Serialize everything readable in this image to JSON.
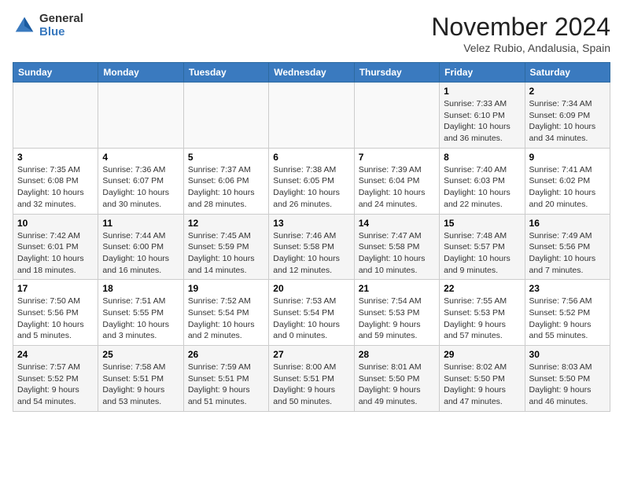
{
  "header": {
    "logo": {
      "general": "General",
      "blue": "Blue"
    },
    "title": "November 2024",
    "location": "Velez Rubio, Andalusia, Spain"
  },
  "weekdays": [
    "Sunday",
    "Monday",
    "Tuesday",
    "Wednesday",
    "Thursday",
    "Friday",
    "Saturday"
  ],
  "weeks": [
    [
      {
        "day": "",
        "info": ""
      },
      {
        "day": "",
        "info": ""
      },
      {
        "day": "",
        "info": ""
      },
      {
        "day": "",
        "info": ""
      },
      {
        "day": "",
        "info": ""
      },
      {
        "day": "1",
        "info": "Sunrise: 7:33 AM\nSunset: 6:10 PM\nDaylight: 10 hours\nand 36 minutes."
      },
      {
        "day": "2",
        "info": "Sunrise: 7:34 AM\nSunset: 6:09 PM\nDaylight: 10 hours\nand 34 minutes."
      }
    ],
    [
      {
        "day": "3",
        "info": "Sunrise: 7:35 AM\nSunset: 6:08 PM\nDaylight: 10 hours\nand 32 minutes."
      },
      {
        "day": "4",
        "info": "Sunrise: 7:36 AM\nSunset: 6:07 PM\nDaylight: 10 hours\nand 30 minutes."
      },
      {
        "day": "5",
        "info": "Sunrise: 7:37 AM\nSunset: 6:06 PM\nDaylight: 10 hours\nand 28 minutes."
      },
      {
        "day": "6",
        "info": "Sunrise: 7:38 AM\nSunset: 6:05 PM\nDaylight: 10 hours\nand 26 minutes."
      },
      {
        "day": "7",
        "info": "Sunrise: 7:39 AM\nSunset: 6:04 PM\nDaylight: 10 hours\nand 24 minutes."
      },
      {
        "day": "8",
        "info": "Sunrise: 7:40 AM\nSunset: 6:03 PM\nDaylight: 10 hours\nand 22 minutes."
      },
      {
        "day": "9",
        "info": "Sunrise: 7:41 AM\nSunset: 6:02 PM\nDaylight: 10 hours\nand 20 minutes."
      }
    ],
    [
      {
        "day": "10",
        "info": "Sunrise: 7:42 AM\nSunset: 6:01 PM\nDaylight: 10 hours\nand 18 minutes."
      },
      {
        "day": "11",
        "info": "Sunrise: 7:44 AM\nSunset: 6:00 PM\nDaylight: 10 hours\nand 16 minutes."
      },
      {
        "day": "12",
        "info": "Sunrise: 7:45 AM\nSunset: 5:59 PM\nDaylight: 10 hours\nand 14 minutes."
      },
      {
        "day": "13",
        "info": "Sunrise: 7:46 AM\nSunset: 5:58 PM\nDaylight: 10 hours\nand 12 minutes."
      },
      {
        "day": "14",
        "info": "Sunrise: 7:47 AM\nSunset: 5:58 PM\nDaylight: 10 hours\nand 10 minutes."
      },
      {
        "day": "15",
        "info": "Sunrise: 7:48 AM\nSunset: 5:57 PM\nDaylight: 10 hours\nand 9 minutes."
      },
      {
        "day": "16",
        "info": "Sunrise: 7:49 AM\nSunset: 5:56 PM\nDaylight: 10 hours\nand 7 minutes."
      }
    ],
    [
      {
        "day": "17",
        "info": "Sunrise: 7:50 AM\nSunset: 5:56 PM\nDaylight: 10 hours\nand 5 minutes."
      },
      {
        "day": "18",
        "info": "Sunrise: 7:51 AM\nSunset: 5:55 PM\nDaylight: 10 hours\nand 3 minutes."
      },
      {
        "day": "19",
        "info": "Sunrise: 7:52 AM\nSunset: 5:54 PM\nDaylight: 10 hours\nand 2 minutes."
      },
      {
        "day": "20",
        "info": "Sunrise: 7:53 AM\nSunset: 5:54 PM\nDaylight: 10 hours\nand 0 minutes."
      },
      {
        "day": "21",
        "info": "Sunrise: 7:54 AM\nSunset: 5:53 PM\nDaylight: 9 hours\nand 59 minutes."
      },
      {
        "day": "22",
        "info": "Sunrise: 7:55 AM\nSunset: 5:53 PM\nDaylight: 9 hours\nand 57 minutes."
      },
      {
        "day": "23",
        "info": "Sunrise: 7:56 AM\nSunset: 5:52 PM\nDaylight: 9 hours\nand 55 minutes."
      }
    ],
    [
      {
        "day": "24",
        "info": "Sunrise: 7:57 AM\nSunset: 5:52 PM\nDaylight: 9 hours\nand 54 minutes."
      },
      {
        "day": "25",
        "info": "Sunrise: 7:58 AM\nSunset: 5:51 PM\nDaylight: 9 hours\nand 53 minutes."
      },
      {
        "day": "26",
        "info": "Sunrise: 7:59 AM\nSunset: 5:51 PM\nDaylight: 9 hours\nand 51 minutes."
      },
      {
        "day": "27",
        "info": "Sunrise: 8:00 AM\nSunset: 5:51 PM\nDaylight: 9 hours\nand 50 minutes."
      },
      {
        "day": "28",
        "info": "Sunrise: 8:01 AM\nSunset: 5:50 PM\nDaylight: 9 hours\nand 49 minutes."
      },
      {
        "day": "29",
        "info": "Sunrise: 8:02 AM\nSunset: 5:50 PM\nDaylight: 9 hours\nand 47 minutes."
      },
      {
        "day": "30",
        "info": "Sunrise: 8:03 AM\nSunset: 5:50 PM\nDaylight: 9 hours\nand 46 minutes."
      }
    ]
  ]
}
